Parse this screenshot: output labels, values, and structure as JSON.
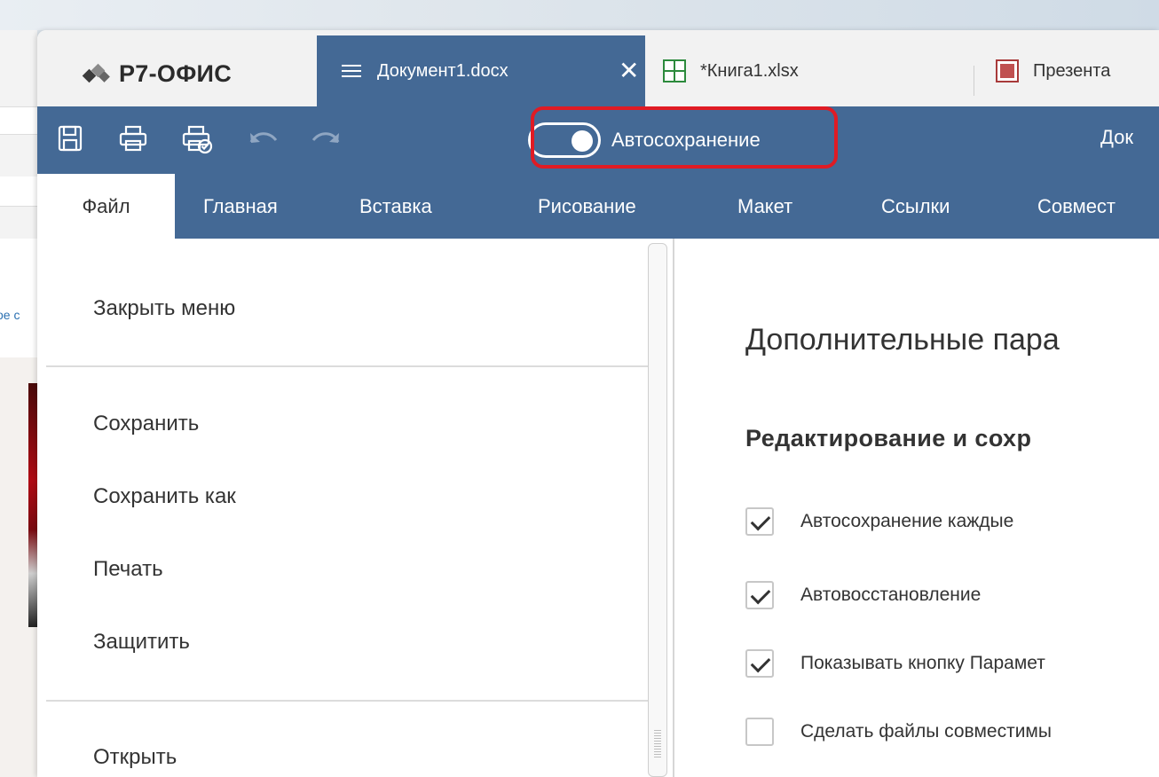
{
  "background": {
    "ghost_text": "ое с"
  },
  "app": {
    "logo_text": "Р7-ОФИС",
    "tabs": [
      {
        "label": "Документ1.docx",
        "active": true,
        "icon": "hamburger-icon"
      },
      {
        "label": "*Книга1.xlsx",
        "active": false,
        "icon": "spreadsheet-icon"
      },
      {
        "label": "Презента",
        "active": false,
        "icon": "presentation-icon"
      }
    ],
    "tab_close_glyph": "✕"
  },
  "toolbar": {
    "icons": [
      "save-icon",
      "print-icon",
      "quick-print-icon",
      "undo-icon",
      "redo-icon"
    ],
    "autosave_label": "Автосохранение",
    "autosave_on": true,
    "doc_title": "Док",
    "highlight_color": "#e01b24"
  },
  "menu_tabs": [
    "Файл",
    "Главная",
    "Вставка",
    "Рисование",
    "Макет",
    "Ссылки",
    "Совмест"
  ],
  "file_menu": {
    "items": {
      "close": "Закрыть меню",
      "save": "Сохранить",
      "save_as": "Сохранить как",
      "print": "Печать",
      "protect": "Защитить",
      "open": "Открыть"
    }
  },
  "settings": {
    "title": "Дополнительные пара",
    "section": "Редактирование и сохр",
    "checkboxes": [
      {
        "label": "Автосохранение каждые",
        "checked": true
      },
      {
        "label": "Автовосстановление",
        "checked": true
      },
      {
        "label": "Показывать кнопку Парамет",
        "checked": true
      },
      {
        "label": "Сделать файлы совместимы",
        "checked": false
      }
    ]
  },
  "colors": {
    "accent": "#446995",
    "tab_bar": "#f2f2f2",
    "xlsx_green": "#2c8a3c",
    "ppt_red": "#a83a3a"
  }
}
